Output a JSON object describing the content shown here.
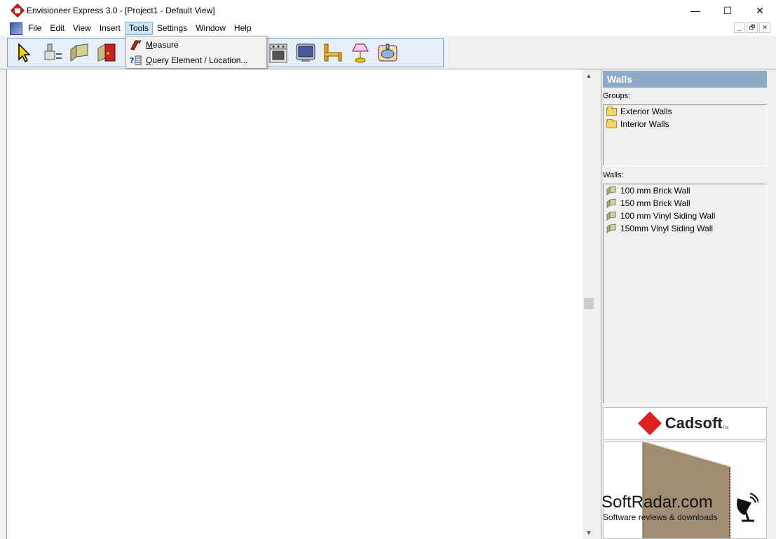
{
  "window": {
    "title": "Envisioneer Express 3.0 - [Project1 - Default View]",
    "minimize": "—",
    "maximize": "☐",
    "close": "✕"
  },
  "menu": {
    "items": [
      "File",
      "Edit",
      "View",
      "Insert",
      "Tools",
      "Settings",
      "Window",
      "Help"
    ],
    "active": "Tools",
    "mdi_minimize": "_",
    "mdi_restore": "🗗",
    "mdi_close": "✕"
  },
  "toolbar": {
    "buttons": [
      "select-pointer",
      "eraser-tool",
      "wall-tool",
      "door-tool",
      "cabinet-tool",
      "appliance-tool",
      "tv-tool",
      "furniture-tool",
      "lamp-tool",
      "bathroom-tool"
    ]
  },
  "tools_menu": {
    "measure_prefix": "",
    "measure_accel": "M",
    "measure_rest": "easure",
    "query_accel": "Q",
    "query_rest": "uery Element / Location..."
  },
  "panel": {
    "header": "Walls",
    "groups_label": "Groups:",
    "groups": [
      "Exterior Walls",
      "Interior Walls"
    ],
    "walls_label": "Walls:",
    "walls": [
      "100 mm Brick Wall",
      "150 mm Brick Wall",
      "100 mm Vinyl Siding Wall",
      "150mm Vinyl Siding Wall"
    ]
  },
  "logo": {
    "text": "Cadsoft",
    "tm": "TM"
  },
  "watermark": {
    "title": "SoftRadar.com",
    "subtitle": "Software reviews & downloads"
  },
  "colors": {
    "accent": "#8fa9c8",
    "menu_highlight": "#cce4f7",
    "toolbar_border": "#7aa6d6",
    "logo_red": "#e02020"
  }
}
